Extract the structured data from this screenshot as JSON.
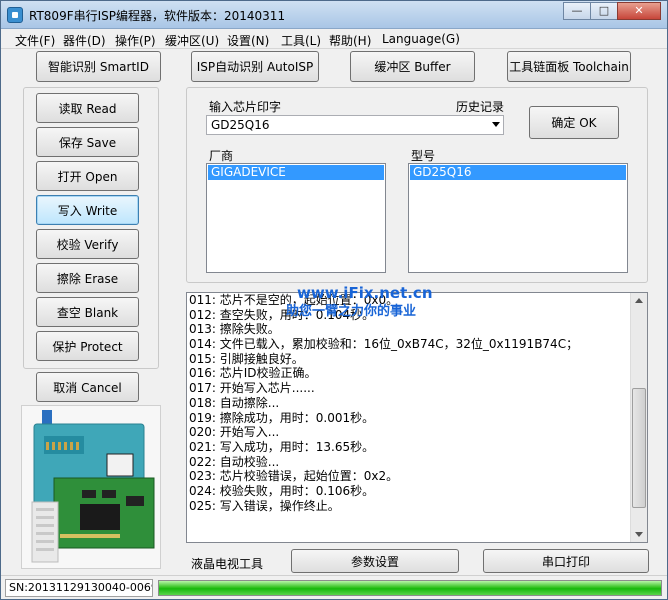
{
  "window": {
    "title": "RT809F串行ISP编程器，软件版本：20140311",
    "minimize_icon": "minimize-icon",
    "restore_icon": "restore-icon",
    "close_icon": "close-icon"
  },
  "menu": {
    "items": [
      {
        "label": "文件(F)"
      },
      {
        "label": "器件(D)"
      },
      {
        "label": "操作(P)"
      },
      {
        "label": "缓冲区(U)"
      },
      {
        "label": "设置(N)"
      },
      {
        "label": "工具(L)"
      },
      {
        "label": "帮助(H)"
      },
      {
        "label": "Language(G)"
      }
    ]
  },
  "toolbar": {
    "smartid": "智能识别 SmartID",
    "autoisp": "ISP自动识别 AutoISP",
    "buffer": "缓冲区 Buffer",
    "toolchain": "工具链面板 Toolchain"
  },
  "operations": {
    "read": "读取 Read",
    "save": "保存 Save",
    "open": "打开 Open",
    "write": "写入 Write",
    "verify": "校验 Verify",
    "erase": "擦除 Erase",
    "blank": "查空 Blank",
    "protect": "保护 Protect",
    "cancel": "取消 Cancel"
  },
  "chip_select": {
    "input_label": "输入芯片印字",
    "history_label": "历史记录",
    "input_value": "GD25Q16",
    "ok_button": "确定 OK",
    "vendor_label": "厂商",
    "vendor_selected": "GIGADEVICE",
    "model_label": "型号",
    "model_selected": "GD25Q16"
  },
  "log": {
    "lines": [
      "011: 芯片不是空的，起始位置：0x0。",
      "012: 查空失败，用时：0.104秒。",
      "013: 擦除失败。",
      "014: 文件已载入，累加校验和：16位_0xB74C，32位_0x1191B74C；",
      "015: 引脚接触良好。",
      "016: 芯片ID校验正确。",
      "017: 开始写入芯片......",
      "018: 自动擦除...",
      "019: 擦除成功，用时：0.001秒。",
      "020: 开始写入...",
      "021: 写入成功，用时：13.65秒。",
      "022: 自动校验...",
      "023: 芯片校验错误，起始位置：0x2。",
      "024: 校验失败，用时：0.106秒。",
      "025: 写入错误，操作终止。"
    ],
    "watermark_url": "www.iFix.net.cn",
    "watermark_slogan": "助您一臂之力你的事业"
  },
  "bottom_bar": {
    "lcd_label": "液晶电视工具",
    "params_button": "参数设置",
    "serial_print_button": "串口打印"
  },
  "status": {
    "serial_number": "SN:20131129130040-0069",
    "progress": 1.0,
    "progress_color": "#17b80d"
  }
}
